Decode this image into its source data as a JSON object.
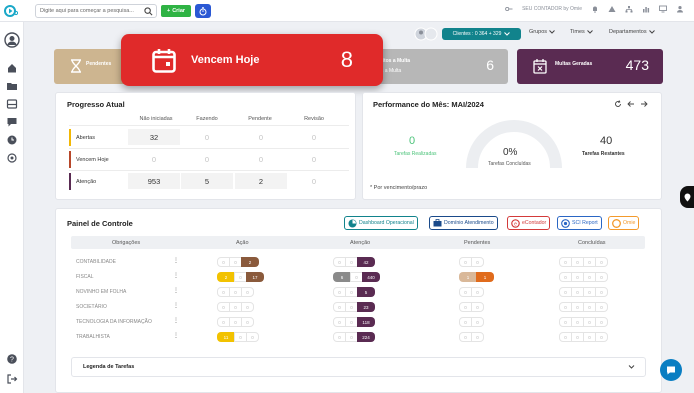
{
  "colors": {
    "accent": "#11838c",
    "alert": "#e02a2a",
    "success": "#2fb344",
    "brand": "#2a58d4"
  },
  "topbar": {
    "search_placeholder": "Digite aqui para começar a pesquisa...",
    "create_label": "Criar",
    "tenant": "SEU CONTADOR by Omie"
  },
  "filters": {
    "clients": "Clientes : 0 364 + 329",
    "groups": "Grupos",
    "teams": "Times",
    "departments": "Departamentos"
  },
  "summary": {
    "pendentes_label": "Pendentes",
    "hero_label": "Vencem Hoje",
    "hero_value": "8",
    "sujeitos_label": "Sujeitos a Multa",
    "sujeitos_sub": "Após a Multa",
    "sujeitos_value": "6",
    "multas_label": "Multas Geradas",
    "multas_value": "473"
  },
  "progress": {
    "title": "Progresso Atual",
    "columns": [
      "Não iniciadas",
      "Fazendo",
      "Pendente",
      "Revisão"
    ],
    "rows": [
      {
        "label": "Abertas",
        "color": "#f2b705",
        "values": [
          "32",
          "0",
          "0",
          "0"
        ]
      },
      {
        "label": "Vencem Hoje",
        "color": "#b7472a",
        "values": [
          "0",
          "0",
          "0",
          "0"
        ]
      },
      {
        "label": "Atenção",
        "color": "#5a2b52",
        "values": [
          "953",
          "5",
          "2",
          "0"
        ]
      }
    ]
  },
  "performance": {
    "title": "Performance do Mês:",
    "month": "MAI/2024",
    "done_value": "0",
    "done_label": "Tarefas Realizadas",
    "pct": "0%",
    "pct_label": "Tarefas Concluídas",
    "rest_value": "40",
    "rest_label": "Tarefas Restantes",
    "note": "* Por vencimento/prazo"
  },
  "control": {
    "title": "Painel de Controle",
    "shortcuts": [
      {
        "label": "Dashboard Operacional",
        "color": "#11838c"
      },
      {
        "label": "Domínio Atendimento",
        "color": "#1a4a8a"
      },
      {
        "label": "eContador",
        "color": "#d33a3a"
      },
      {
        "label": "SCI Report",
        "color": "#2a66c4"
      },
      {
        "label": "Omie",
        "color": "#f39a2c"
      }
    ],
    "headers": [
      "Obrigações",
      "Ação",
      "Atenção",
      "Pendentes",
      "Concluídas"
    ],
    "rows": [
      {
        "name": "CONTABILIDADE",
        "acao": [
          "0",
          "0",
          "2"
        ],
        "atencao": [
          "0",
          "0",
          "42"
        ],
        "pend": [
          "0",
          "0"
        ],
        "conc": [
          "0",
          "0",
          "0",
          "0"
        ]
      },
      {
        "name": "FISCAL",
        "acao": [
          "2",
          "0",
          "17"
        ],
        "atencao": [
          "6",
          "0",
          "440"
        ],
        "pend": [
          "1",
          "1"
        ],
        "conc": [
          "0",
          "0",
          "0",
          "0"
        ]
      },
      {
        "name": "NOVINHO EM FOLHA",
        "acao": [
          "0",
          "0",
          "0"
        ],
        "atencao": [
          "0",
          "0",
          "5"
        ],
        "pend": [
          "0",
          "0"
        ],
        "conc": [
          "0",
          "0",
          "0",
          "0"
        ]
      },
      {
        "name": "SOCIETÁRIO",
        "acao": [
          "0",
          "0",
          "0"
        ],
        "atencao": [
          "0",
          "0",
          "23"
        ],
        "pend": [
          "0",
          "0"
        ],
        "conc": [
          "0",
          "0",
          "0",
          "0"
        ]
      },
      {
        "name": "TECNOLOGIA DA INFORMAÇÃO",
        "acao": [
          "0",
          "0",
          "0"
        ],
        "atencao": [
          "0",
          "0",
          "118"
        ],
        "pend": [
          "0",
          "0"
        ],
        "conc": [
          "0",
          "0",
          "0",
          "0"
        ]
      },
      {
        "name": "TRABALHISTA",
        "acao": [
          "11",
          "0",
          "0"
        ],
        "atencao": [
          "0",
          "0",
          "224"
        ],
        "pend": [
          "0",
          "0"
        ],
        "conc": [
          "0",
          "0",
          "0",
          "0"
        ]
      }
    ],
    "legend_title": "Legenda de Tarefas"
  }
}
